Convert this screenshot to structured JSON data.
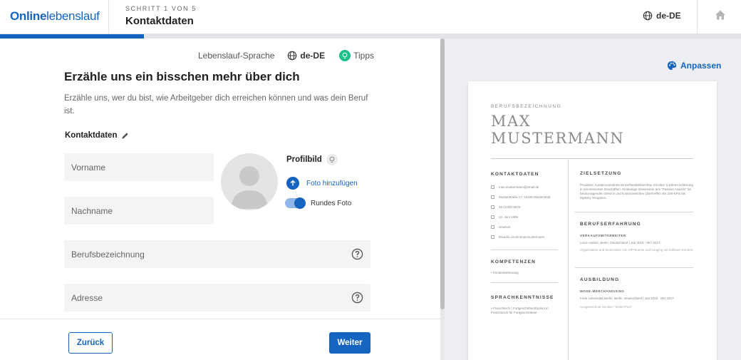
{
  "header": {
    "logo_bold": "Online",
    "logo_light": "lebenslauf",
    "step": "SCHRITT 1 VON 5",
    "title": "Kontaktdaten",
    "language": "de-DE",
    "progress_fraction": 0.194
  },
  "form": {
    "lang_label": "Lebenslauf-Sprache",
    "lang_value": "de-DE",
    "tips_label": "Tipps",
    "heading": "Erzähle uns ein bisschen mehr über dich",
    "intro": "Erzähle uns, wer du bist, wie Arbeitgeber dich erreichen können und was dein Beruf ist.",
    "section": "Kontaktdaten",
    "fields": {
      "vorname": "Vorname",
      "nachname": "Nachname",
      "beruf": "Berufsbezeichnung",
      "adresse": "Adresse"
    },
    "photo": {
      "label": "Profilbild",
      "add": "Foto hinzufügen",
      "round": "Rundes Foto",
      "round_enabled": true
    },
    "back": "Zurück",
    "next": "Weiter"
  },
  "preview": {
    "customize": "Anpassen",
    "job": "BERUFSBEZEICHNUNG",
    "name_line1": "MAX",
    "name_line2": "MUSTERMANN",
    "contact_heading": "KONTAKTDATEN",
    "contact": [
      "max.mustermann@email.de",
      "Musterstraße 17, 12345 Musterstadt",
      "49 (1234) 5678",
      "22. Juni 1989",
      "Deutsch",
      "linkedin.com/in/maxmustermann"
    ],
    "skills_heading": "KOMPETENZEN",
    "skills": [
      "Kundenbetreuung"
    ],
    "languages_heading": "SPRACHKENNTNISSE",
    "languages": [
      "Französisch | Fortgeschritten/Diplom in Französisch für Fortgeschrittene"
    ],
    "objective_heading": "ZIELSETZUNG",
    "objective": "Proaktive, kundenorientierte Einzelhandelsfachfrau mit über 4 Jahren Erfahrung in renommierten Geschäften. Eindeutige Gewinnerin des \"Passion Awards\" für herausragenden Service und kontinuierliches Übertreffen der Ziel-KPIs bei Mystery Shoppern.",
    "experience_heading": "BERUFSERFAHRUNG",
    "experience_role": "VERKAUFSMITARBEITER",
    "experience_line": "Louis Vuitton, Berlin, Deutschland | Jun 2016 - Mrz 2017",
    "experience_desc": "Organisation und Moderation von VIP-Events und Imaging mit Exklusiv-Kunden.",
    "education_heading": "AUSBILDUNG",
    "education_role": "MODE-MERCHANDISING",
    "education_line": "Freie Universität Berlin, Berlin, Deutschland | Jun 2016 - Mrz 2017",
    "education_desc": "Ausgezeichnet mit dem \"ICSB Preis\""
  },
  "colors": {
    "accent": "#1565c0",
    "tips": "#1cc08a",
    "field_bg": "#f3f4f6"
  }
}
